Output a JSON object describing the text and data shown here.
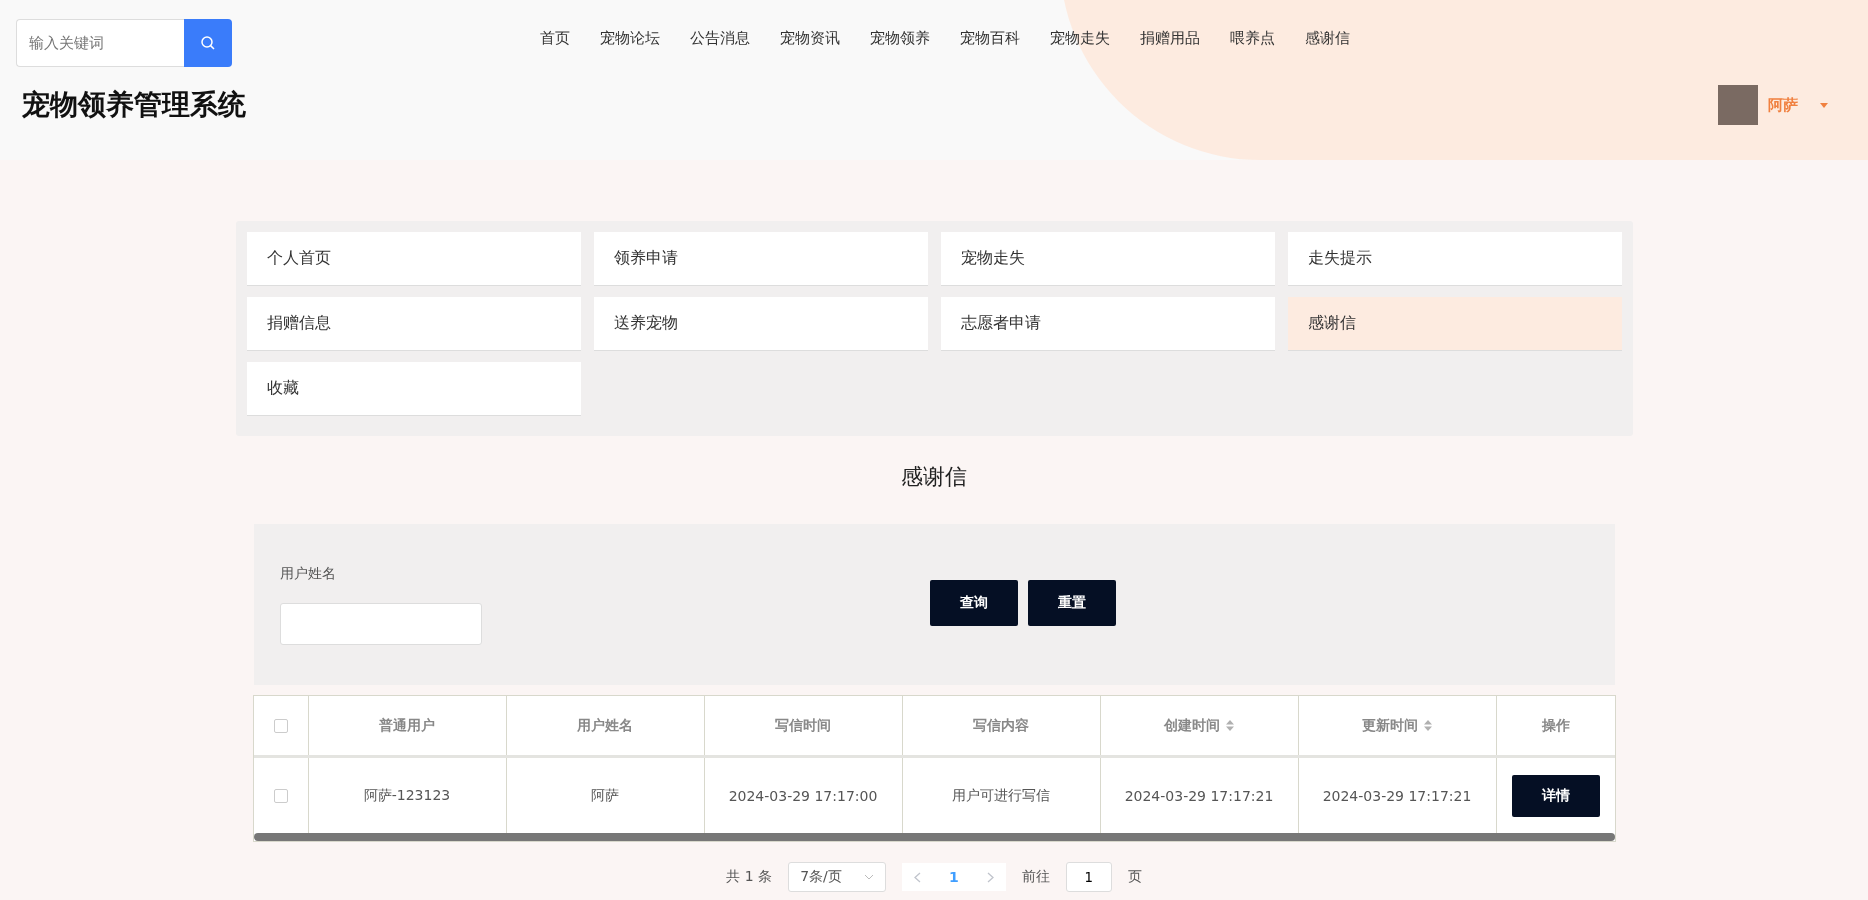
{
  "search": {
    "placeholder": "输入关键词"
  },
  "nav": [
    "首页",
    "宠物论坛",
    "公告消息",
    "宠物资讯",
    "宠物领养",
    "宠物百科",
    "宠物走失",
    "捐赠用品",
    "喂养点",
    "感谢信"
  ],
  "site_title": "宠物领养管理系统",
  "user": {
    "name": "阿萨"
  },
  "menu": [
    {
      "label": "个人首页",
      "selected": false
    },
    {
      "label": "领养申请",
      "selected": false
    },
    {
      "label": "宠物走失",
      "selected": false
    },
    {
      "label": "走失提示",
      "selected": false
    },
    {
      "label": "捐赠信息",
      "selected": false
    },
    {
      "label": "送养宠物",
      "selected": false
    },
    {
      "label": "志愿者申请",
      "selected": false
    },
    {
      "label": "感谢信",
      "selected": true
    },
    {
      "label": "收藏",
      "selected": false
    }
  ],
  "page_title": "感谢信",
  "filter": {
    "label": "用户姓名",
    "buttons": [
      "查询",
      "重置"
    ]
  },
  "table": {
    "select_all_checked": false,
    "columns": [
      {
        "label": "普通用户",
        "sortable": false
      },
      {
        "label": "用户姓名",
        "sortable": false
      },
      {
        "label": "写信时间",
        "sortable": false
      },
      {
        "label": "写信内容",
        "sortable": false
      },
      {
        "label": "创建时间",
        "sortable": true
      },
      {
        "label": "更新时间",
        "sortable": true
      },
      {
        "label": "操作",
        "sortable": false
      }
    ],
    "rows": [
      {
        "checked": false,
        "cells": [
          "阿萨-123123",
          "阿萨",
          "2024-03-29 17:17:00",
          "用户可进行写信",
          "2024-03-29 17:17:21",
          "2024-03-29 17:17:21"
        ],
        "action": "详情"
      }
    ]
  },
  "pagination": {
    "total": "共 1 条",
    "page_size": "7条/页",
    "pages": [
      {
        "label": "1",
        "selected": true
      }
    ],
    "goto_label": "前往",
    "goto_value": "1",
    "goto_suffix": "页"
  }
}
